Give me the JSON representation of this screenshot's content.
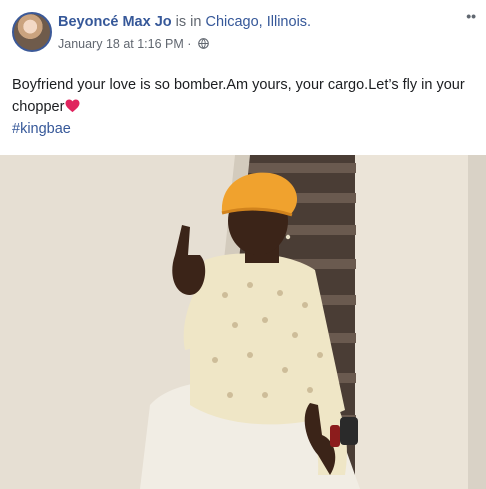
{
  "post": {
    "author": "Beyoncé Max Jo",
    "location_prefix": " is in ",
    "location": "Chicago, Illinois.",
    "timestamp": "January 18 at 1:16 PM",
    "separator": " · ",
    "privacy_icon": "globe-icon",
    "more_icon": "more-options-icon",
    "text_line1": "Boyfriend your love is so bomber.Am yours, your cargo.Let’s fly in your",
    "text_line2": "chopper",
    "emoji": "red-heart-icon",
    "hashtag": "#kingbae",
    "photo_icon": "photo"
  },
  "colors": {
    "link": "#365899",
    "meta": "#616770",
    "text": "#1c1e21",
    "heart": "#e0245e",
    "durag": "#f0a22e",
    "shirt": "#efe6c6",
    "wall": "#e9e2d6"
  }
}
